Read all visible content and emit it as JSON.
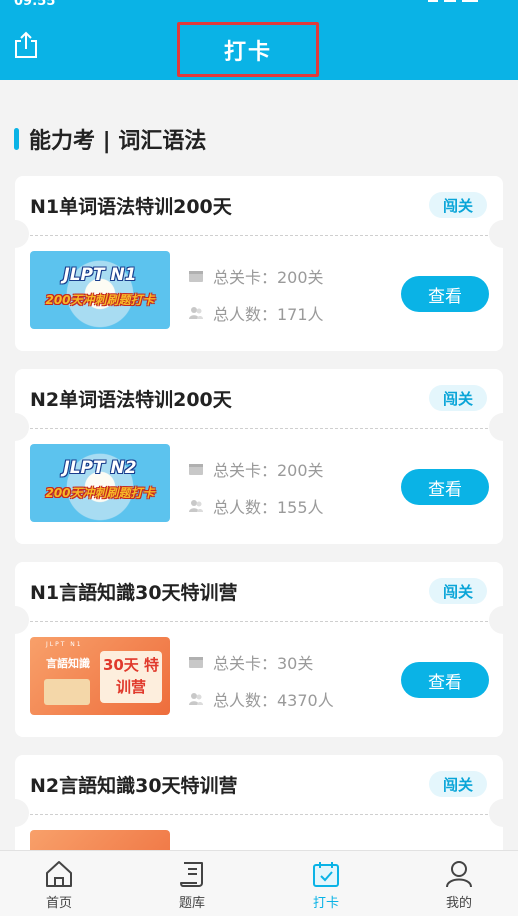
{
  "status": {
    "time": "09:55"
  },
  "header": {
    "title": "打卡"
  },
  "section": {
    "title": "能力考 | 词汇语法"
  },
  "cards": [
    {
      "title": "N1单词语法特训200天",
      "tag": "闯关",
      "thumb_line1": "JLPT N1",
      "thumb_line2": "200天冲刺刷题打卡",
      "stat1": "总关卡：200关",
      "stat2": "总人数：171人",
      "button": "查看"
    },
    {
      "title": "N2单词语法特训200天",
      "tag": "闯关",
      "thumb_line1": "JLPT N2",
      "thumb_line2": "200天冲刺刷题打卡",
      "stat1": "总关卡：200关",
      "stat2": "总人数：155人",
      "button": "查看"
    },
    {
      "title": "N1言語知識30天特训营",
      "tag": "闯关",
      "thumb_sub": "JLPT N1",
      "thumb_left": "言語知識",
      "thumb_panel": "30天 特训营",
      "stat1": "总关卡：30关",
      "stat2": "总人数：4370人",
      "button": "查看"
    },
    {
      "title": "N2言語知識30天特训营",
      "tag": "闯关"
    }
  ],
  "nav": [
    {
      "label": "首页",
      "icon": "home-icon"
    },
    {
      "label": "题库",
      "icon": "question-bank-icon"
    },
    {
      "label": "打卡",
      "icon": "checkin-calendar-icon",
      "active": true
    },
    {
      "label": "我的",
      "icon": "profile-icon"
    }
  ],
  "colors": {
    "accent": "#0ab3e6",
    "highlight_border": "#e03a3a",
    "tag_bg": "#e4f6fc"
  }
}
